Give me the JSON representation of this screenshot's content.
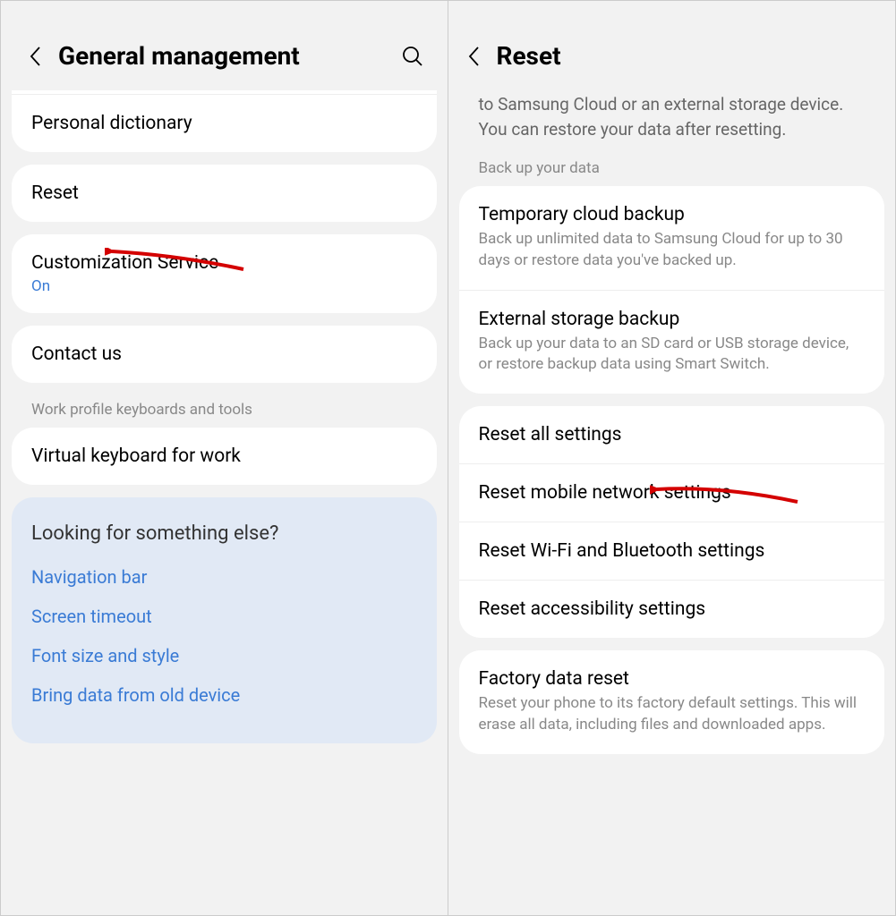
{
  "left": {
    "header": {
      "title": "General management"
    },
    "items": {
      "personal_dictionary": "Personal dictionary",
      "reset": "Reset",
      "customization_service": "Customization Service",
      "customization_status": "On",
      "contact_us": "Contact us"
    },
    "work_section_label": "Work profile keyboards and tools",
    "work_item": "Virtual keyboard for work",
    "suggest": {
      "title": "Looking for something else?",
      "links": [
        "Navigation bar",
        "Screen timeout",
        "Font size and style",
        "Bring data from old device"
      ]
    }
  },
  "right": {
    "header": {
      "title": "Reset"
    },
    "intro": "to Samsung Cloud or an external storage device. You can restore your data after resetting.",
    "backup_section": "Back up your data",
    "backup": {
      "temp_title": "Temporary cloud backup",
      "temp_sub": "Back up unlimited data to Samsung Cloud for up to 30 days or restore data you've backed up.",
      "ext_title": "External storage backup",
      "ext_sub": "Back up your data to an SD card or USB storage device, or restore backup data using Smart Switch."
    },
    "reset": {
      "all": "Reset all settings",
      "network": "Reset mobile network settings",
      "wifi": "Reset Wi-Fi and Bluetooth settings",
      "accessibility": "Reset accessibility settings"
    },
    "factory": {
      "title": "Factory data reset",
      "sub": "Reset your phone to its factory default settings. This will erase all data, including files and downloaded apps."
    }
  }
}
